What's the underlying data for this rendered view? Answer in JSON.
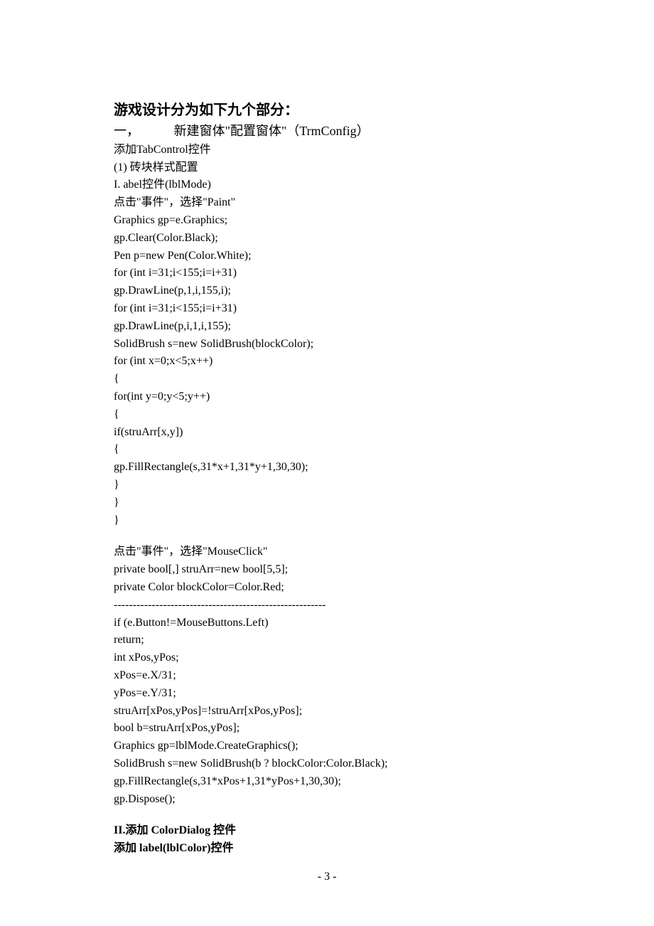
{
  "title": "游戏设计分为如下九个部分：",
  "section1": {
    "num": "一，",
    "text": "新建窗体\"配置窗体\"（TrmConfig）"
  },
  "add_tabcontrol": "添加TabControl控件",
  "sub1": "(1) 砖块样式配置",
  "label_ctrl": "I. abel控件(lblMode)",
  "paint_event": "点击\"事件\"，选择\"Paint\"",
  "code1": [
    "Graphics gp=e.Graphics;",
    "gp.Clear(Color.Black);",
    "Pen p=new Pen(Color.White);",
    "for (int i=31;i<155;i=i+31)",
    "gp.DrawLine(p,1,i,155,i);",
    "for (int i=31;i<155;i=i+31)",
    "gp.DrawLine(p,i,1,i,155);",
    "SolidBrush s=new SolidBrush(blockColor);",
    "for (int x=0;x<5;x++)",
    "{",
    "for(int y=0;y<5;y++)",
    "{",
    "if(struArr[x,y])",
    "{",
    "gp.FillRectangle(s,31*x+1,31*y+1,30,30);",
    "}",
    "}",
    "}"
  ],
  "mouse_event": "点击\"事件\"，选择\"MouseClick\"",
  "code2": [
    "private bool[,] struArr=new bool[5,5];",
    "private Color blockColor=Color.Red;",
    "--------------------------------------------------------",
    "if (e.Button!=MouseButtons.Left)",
    "return;",
    "int xPos,yPos;",
    "xPos=e.X/31;",
    "yPos=e.Y/31;",
    "struArr[xPos,yPos]=!struArr[xPos,yPos];",
    "bool b=struArr[xPos,yPos];",
    "Graphics gp=lblMode.CreateGraphics();",
    "SolidBrush s=new SolidBrush(b ? blockColor:Color.Black);",
    "gp.FillRectangle(s,31*xPos+1,31*yPos+1,30,30);",
    "gp.Dispose();"
  ],
  "add_colordialog": "II.添加 ColorDialog 控件",
  "add_label_lblcolor": "添加 label(lblColor)控件",
  "page_number": "- 3 -"
}
